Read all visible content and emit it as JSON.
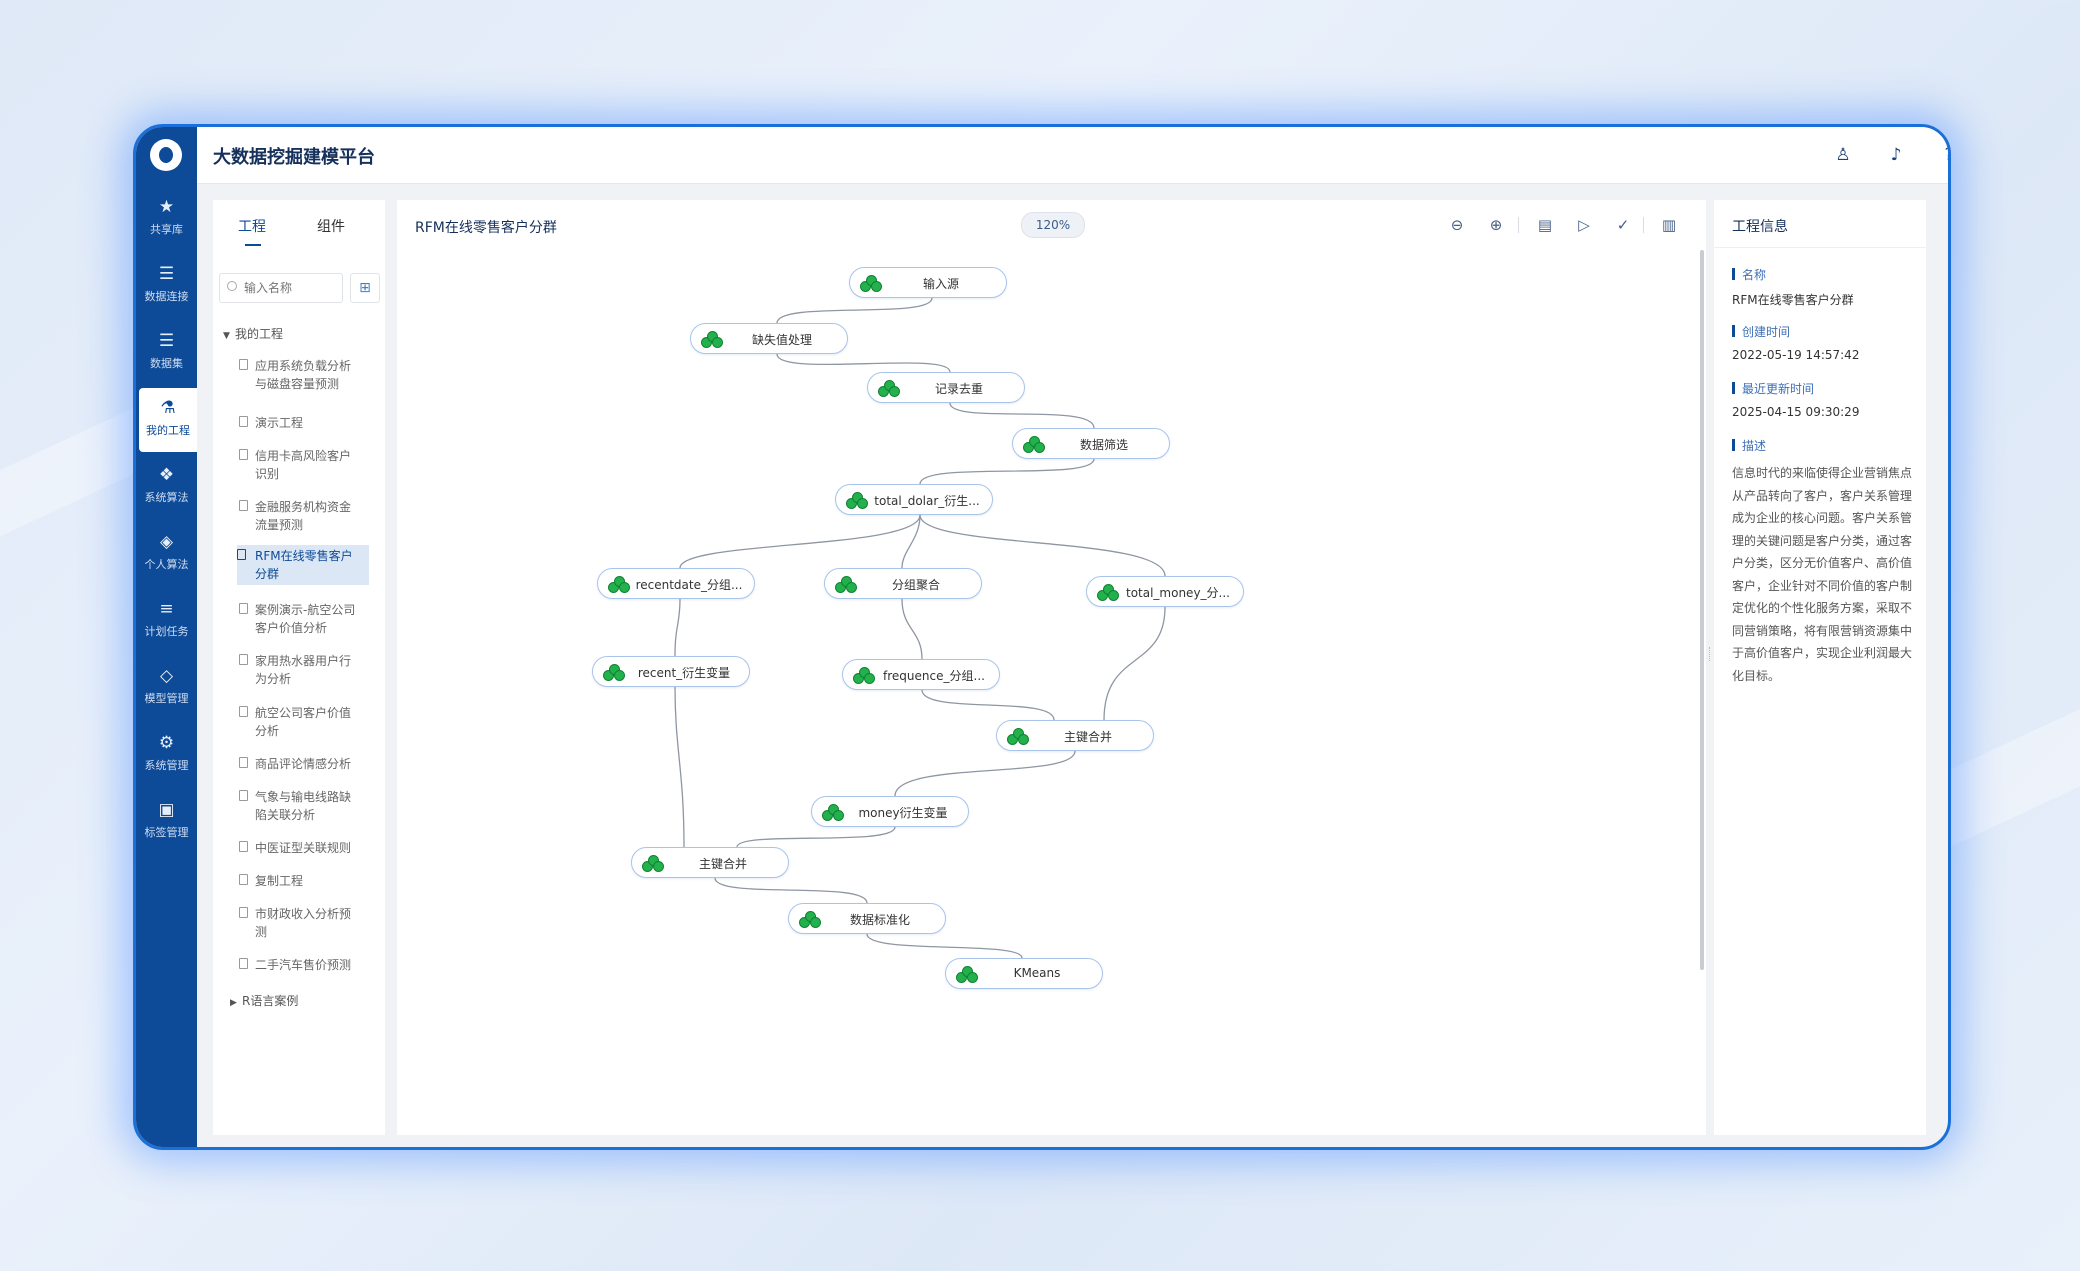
{
  "app": {
    "title": "大数据挖掘建模平台"
  },
  "nav": {
    "items": [
      {
        "label": "共享库",
        "icon": "star-icon"
      },
      {
        "label": "数据连接",
        "icon": "database-icon"
      },
      {
        "label": "数据集",
        "icon": "dataset-icon"
      },
      {
        "label": "我的工程",
        "icon": "flask-icon"
      },
      {
        "label": "系统算法",
        "icon": "cubes-icon"
      },
      {
        "label": "个人算法",
        "icon": "cube-icon"
      },
      {
        "label": "计划任务",
        "icon": "list-icon"
      },
      {
        "label": "模型管理",
        "icon": "diamond-icon"
      },
      {
        "label": "系统管理",
        "icon": "gear-icon"
      },
      {
        "label": "标签管理",
        "icon": "clipboard-icon"
      }
    ],
    "active": "我的工程"
  },
  "header_icons": [
    "user-icon",
    "bell-icon",
    "help-icon",
    "message-icon",
    "logout-icon"
  ],
  "left_panel": {
    "tabs": [
      {
        "label": "工程"
      },
      {
        "label": "组件"
      }
    ],
    "active_tab": "工程",
    "search_placeholder": "输入名称",
    "tree": {
      "root_label": "我的工程",
      "items": [
        "应用系统负载分析与磁盘容量预测",
        "演示工程",
        "信用卡高风险客户识别",
        "金融服务机构资金流量预测",
        "RFM在线零售客户分群",
        "案例演示-航空公司客户价值分析",
        "家用热水器用户行为分析",
        "航空公司客户价值分析",
        "商品评论情感分析",
        "气象与输电线路缺陷关联分析",
        "中医证型关联规则",
        "复制工程",
        "市财政收入分析预测",
        "二手汽车售价预测"
      ],
      "active_item": "RFM在线零售客户分群",
      "collapsed_root_label": "R语言案例"
    }
  },
  "canvas": {
    "title": "RFM在线零售客户分群",
    "zoom": "120%",
    "toolbar": [
      "zoom-out-icon",
      "zoom-in-icon",
      "save-icon",
      "run-icon",
      "check-icon",
      "panel-icon"
    ],
    "nodes": [
      "输入源",
      "缺失值处理",
      "记录去重",
      "数据筛选",
      "total_dolar_衍生...",
      "recentdate_分组...",
      "分组聚合",
      "total_money_分...",
      "recent_衍生变量",
      "frequence_分组...",
      "主键合并",
      "money衍生变量",
      "主键合并",
      "数据标准化",
      "KMeans"
    ]
  },
  "right_panel": {
    "title": "工程信息",
    "name_label": "名称",
    "name_value": "RFM在线零售客户分群",
    "created_label": "创建时间",
    "created_value": "2022-05-19 14:57:42",
    "updated_label": "最近更新时间",
    "updated_value": "2025-04-15 09:30:29",
    "desc_label": "描述",
    "desc_value": "信息时代的来临使得企业营销焦点从产品转向了客户，客户关系管理成为企业的核心问题。客户关系管理的关键问题是客户分类，通过客户分类，区分无价值客户、高价值客户，企业针对不同价值的客户制定优化的个性化服务方案，采取不同营销策略，将有限营销资源集中于高价值客户，实现企业利润最大化目标。"
  }
}
